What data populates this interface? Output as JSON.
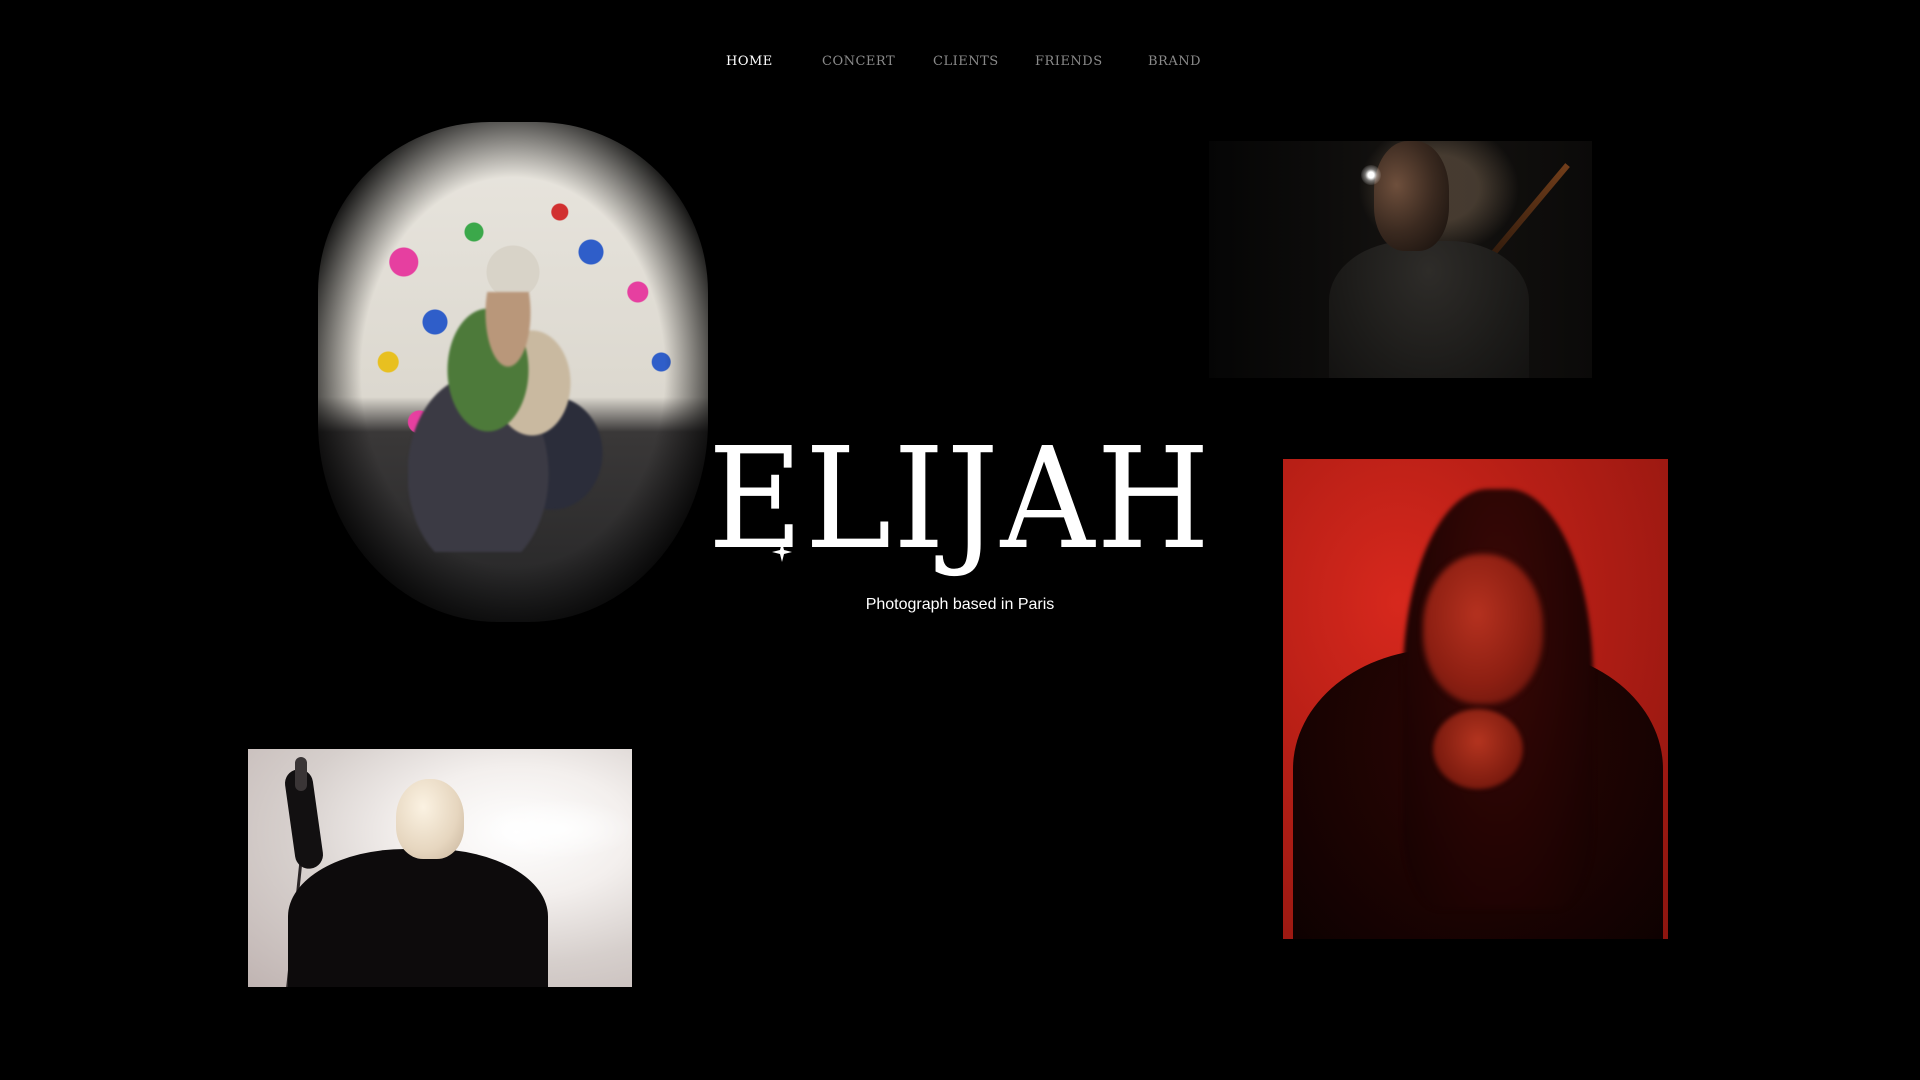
{
  "nav": {
    "items": [
      {
        "label": "HOME",
        "active": true
      },
      {
        "label": "CONCERT",
        "active": false
      },
      {
        "label": "CLIENTS",
        "active": false
      },
      {
        "label": "FRIENDS",
        "active": false
      },
      {
        "label": "BRAND",
        "active": false
      }
    ]
  },
  "hero": {
    "title": "ELIJAH",
    "subtitle": "Photograph based in Paris",
    "sparkle_icon": "sparkle-icon"
  },
  "colors": {
    "background": "#000000",
    "text": "#ffffff",
    "nav_inactive": "#8a8a8a"
  }
}
